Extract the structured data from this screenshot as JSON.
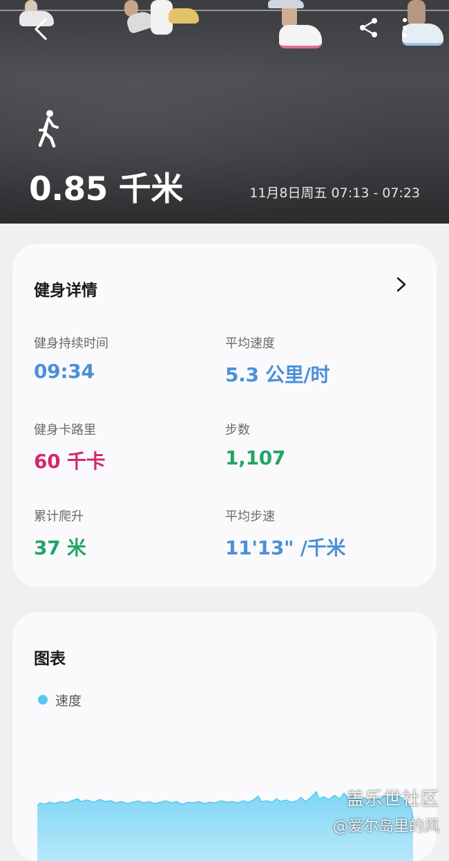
{
  "header": {
    "distance": "0.85 千米",
    "datetime": "11月8日周五 07:13 - 07:23",
    "activity_icon": "walking-person-icon",
    "back_icon": "back-arrow-icon",
    "share_icon": "share-icon",
    "more_icon": "more-vertical-icon"
  },
  "details": {
    "title": "健身详情",
    "stats": [
      {
        "label": "健身持续时间",
        "value": "09:34",
        "color": "#4a90d9"
      },
      {
        "label": "平均速度",
        "value": "5.3 公里/时",
        "color": "#4a90d9"
      },
      {
        "label": "健身卡路里",
        "value": "60 千卡",
        "color": "#d6266f"
      },
      {
        "label": "步数",
        "value": "1,107",
        "color": "#22a565"
      },
      {
        "label": "累计爬升",
        "value": "37 米",
        "color": "#22a565"
      },
      {
        "label": "平均步速",
        "value": "11'13\" /千米",
        "color": "#4a90d9"
      }
    ]
  },
  "chart": {
    "title": "图表",
    "legend": "速度",
    "color": "#5ac8ee"
  },
  "watermark": {
    "line1": "盖乐世社区",
    "line2": "@爱尔岛里的风"
  }
}
